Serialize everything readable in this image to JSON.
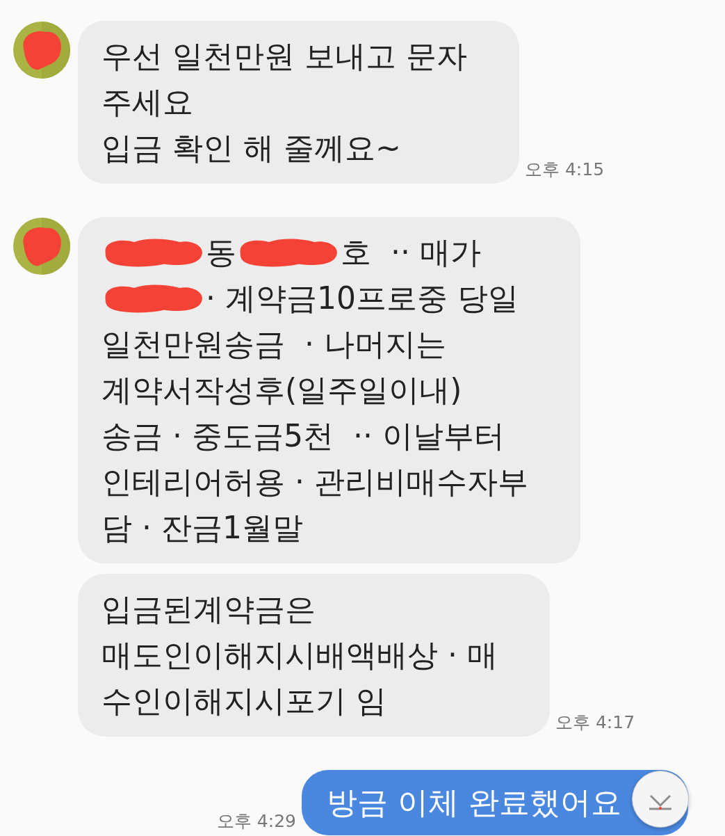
{
  "groups": [
    {
      "kind": "incoming",
      "time": "오후 4:15",
      "bubbles": [
        {
          "lines": [
            [
              {
                "kind": "text",
                "text": "우선 일천만원 보내고 문자"
              }
            ],
            [
              {
                "kind": "text",
                "text": "주세요"
              }
            ],
            [
              {
                "kind": "text",
                "text": "입금 확인 해 줄께요~"
              }
            ]
          ]
        }
      ]
    },
    {
      "kind": "incoming",
      "time": "오후 4:17",
      "bubbles": [
        {
          "lines": [
            [
              {
                "kind": "redacted"
              },
              {
                "kind": "text",
                "text": "동"
              },
              {
                "kind": "redacted"
              },
              {
                "kind": "text",
                "text": "호  ·· 매가"
              }
            ],
            [
              {
                "kind": "redacted"
              },
              {
                "kind": "text",
                "text": "· 계약금10프로중 당일"
              }
            ],
            [
              {
                "kind": "text",
                "text": "일천만원송금  · 나머지는"
              }
            ],
            [
              {
                "kind": "text",
                "text": "계약서작성후(일주일이내)"
              }
            ],
            [
              {
                "kind": "text",
                "text": "송금 · 중도금5천  ·· 이날부터"
              }
            ],
            [
              {
                "kind": "text",
                "text": "인테리어허용 · 관리비매수자부"
              }
            ],
            [
              {
                "kind": "text",
                "text": "담 · 잔금1월말"
              }
            ]
          ]
        },
        {
          "lines": [
            [
              {
                "kind": "text",
                "text": "입금된계약금은"
              }
            ],
            [
              {
                "kind": "text",
                "text": "매도인이해지시배액배상 · 매"
              }
            ],
            [
              {
                "kind": "text",
                "text": "수인이해지시포기 임"
              }
            ]
          ]
        }
      ]
    },
    {
      "kind": "outgoing",
      "time": "오후 4:29",
      "bubbles": [
        {
          "lines": [
            [
              {
                "kind": "text",
                "text": "방금 이체 완료했어요"
              }
            ]
          ]
        }
      ]
    }
  ]
}
